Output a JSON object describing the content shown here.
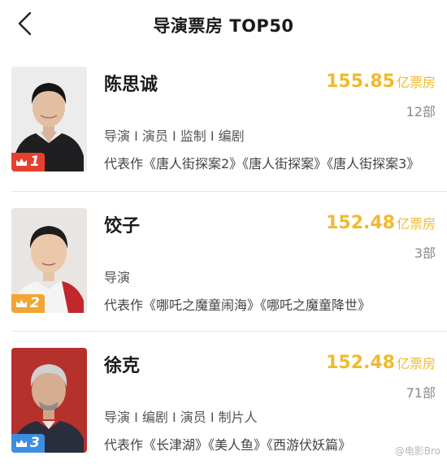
{
  "header": {
    "title": "导演票房 TOP50",
    "back_icon": "chevron-left-icon"
  },
  "colors": {
    "accent": "#f1b92d",
    "rank1_badge": "#e8402f",
    "rank2_badge": "#f3a533",
    "rank3_badge": "#3d8ee0"
  },
  "directors": [
    {
      "rank": "1",
      "name": "陈思诚",
      "box_value": "155.85",
      "box_unit": "亿票房",
      "film_count": "12部",
      "roles": "导演 I 演员 I 监制 I 编剧",
      "works": "代表作《唐人街探案2》《唐人街探案》《唐人街探案3》"
    },
    {
      "rank": "2",
      "name": "饺子",
      "box_value": "152.48",
      "box_unit": "亿票房",
      "film_count": "3部",
      "roles": "导演",
      "works": "代表作《哪吒之魔童闹海》《哪吒之魔童降世》"
    },
    {
      "rank": "3",
      "name": "徐克",
      "box_value": "152.48",
      "box_unit": "亿票房",
      "film_count": "71部",
      "roles": "导演 I 编剧 I 演员 I 制片人",
      "works": "代表作《长津湖》《美人鱼》《西游伏妖篇》"
    }
  ],
  "watermark": "@电影Bro"
}
